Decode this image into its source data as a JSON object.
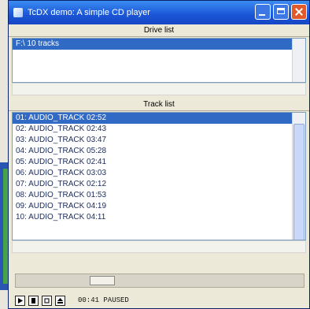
{
  "window": {
    "title": "TcDX demo: A simple CD player"
  },
  "drive_list": {
    "header": "Drive list",
    "items": [
      "F:\\ 10 tracks"
    ]
  },
  "track_list": {
    "header": "Track list",
    "tracks": [
      "01: AUDIO_TRACK 02:52",
      "02: AUDIO_TRACK 02:43",
      "03: AUDIO_TRACK 03:47",
      "04: AUDIO_TRACK 05:28",
      "05: AUDIO_TRACK 02:41",
      "06: AUDIO_TRACK 03:03",
      "07: AUDIO_TRACK 02:12",
      "08: AUDIO_TRACK 01:53",
      "09: AUDIO_TRACK 04:19",
      "10: AUDIO_TRACK 04:11"
    ],
    "selected_index": 0
  },
  "playback": {
    "position_fraction": 0.28,
    "status_text": "00:41 PAUSED"
  },
  "controls": [
    "play-icon",
    "pause-icon",
    "stop-icon",
    "eject-icon"
  ]
}
